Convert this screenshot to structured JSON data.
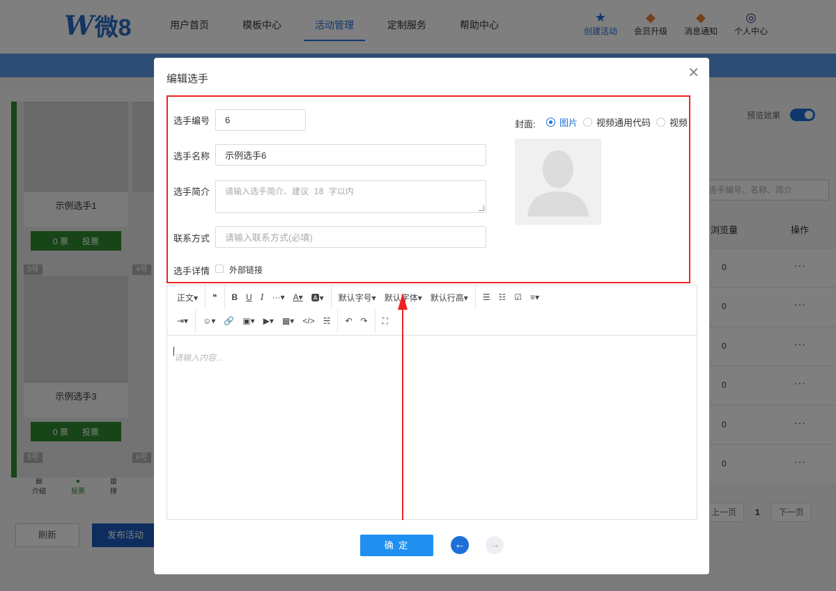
{
  "header": {
    "logo_text": "微8",
    "nav": [
      "用户首页",
      "模板中心",
      "活动管理",
      "定制服务",
      "帮助中心"
    ],
    "right": [
      "创建活动",
      "会员升级",
      "消息通知",
      "个人中心"
    ]
  },
  "page": {
    "players": [
      {
        "name": "示例选手1",
        "votes": "0 票",
        "vote_btn": "投票"
      },
      {
        "name": "示例选手3",
        "votes": "0 票",
        "vote_btn": "投票"
      }
    ],
    "num_tags": [
      "3号",
      "4号",
      "5号",
      "6号"
    ],
    "bottom_nav": [
      "介绍",
      "投票",
      "排"
    ],
    "refresh": "刷新",
    "publish": "发布活动",
    "preview_label": "预览效果",
    "search_placeholder": "选手编号、名称、简介",
    "col_views": "浏览量",
    "col_ops": "操作",
    "rows": [
      "0",
      "0",
      "0",
      "0",
      "0",
      "0"
    ],
    "more": "···",
    "pager": {
      "prev": "上一页",
      "current": "1",
      "next": "下一页"
    }
  },
  "modal": {
    "title": "编辑选手",
    "fields": {
      "number_label": "选手编号",
      "number_value": "6",
      "name_label": "选手名称",
      "name_value": "示例选手6",
      "intro_label": "选手简介",
      "intro_placeholder": "请输入选手简介、建议 18 字以内",
      "contact_label": "联系方式",
      "contact_placeholder": "请输入联系方式(必填)",
      "detail_label": "选手详情",
      "external_link": "外部链接"
    },
    "cover": {
      "label": "封面:",
      "options": [
        "图片",
        "视频通用代码",
        "视频"
      ],
      "selected": "图片"
    },
    "toolbar_row1": [
      "正文▾",
      "❝",
      "B",
      "U",
      "I",
      "···▾",
      "A▾",
      "🅰▾",
      "默认字号▾",
      "默认字体▾",
      "默认行高▾",
      "☰",
      "☷",
      "☑",
      "≡▾"
    ],
    "toolbar_row2": [
      "⇥▾",
      "☺▾",
      "🔗",
      "▣▾",
      "▶▾",
      "▦▾",
      "</>",
      "☵",
      "↶",
      "↷",
      "⛶"
    ],
    "editor_placeholder": "请输入内容...",
    "ok": "确 定"
  },
  "colors": {
    "accent": "#1f6fd8",
    "highlight": "#e22222",
    "green": "#2e8b2e"
  }
}
